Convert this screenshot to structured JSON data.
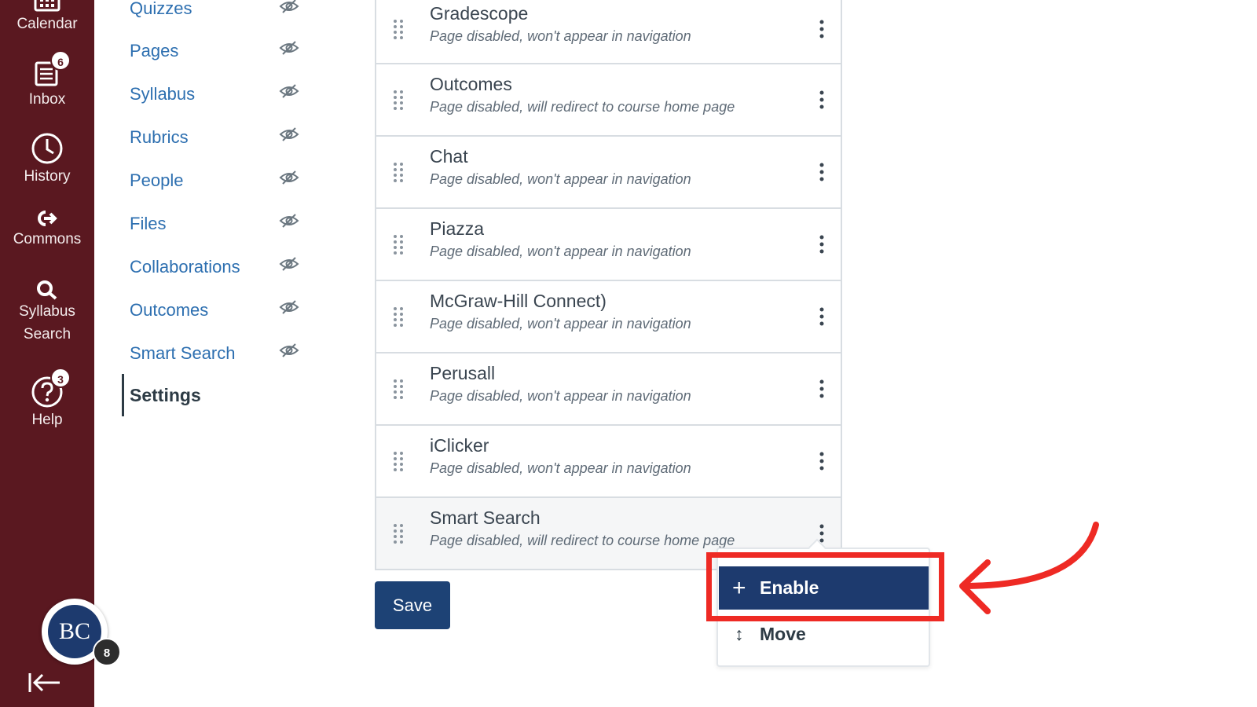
{
  "global_nav": {
    "calendar_label": "Calendar",
    "inbox_label": "Inbox",
    "inbox_badge": "6",
    "history_label": "History",
    "commons_label": "Commons",
    "syllabus_search_label_1": "Syllabus",
    "syllabus_search_label_2": "Search",
    "help_label": "Help",
    "help_badge": "3",
    "avatar_initials": "BC",
    "avatar_badge": "8"
  },
  "course_nav": {
    "items": [
      {
        "label": "Quizzes",
        "icon": "eye-slash-icon"
      },
      {
        "label": "Pages",
        "icon": "eye-slash-icon"
      },
      {
        "label": "Syllabus",
        "icon": "eye-slash-icon"
      },
      {
        "label": "Rubrics",
        "icon": "eye-slash-icon"
      },
      {
        "label": "People",
        "icon": "eye-slash-icon"
      },
      {
        "label": "Files",
        "icon": "eye-slash-icon"
      },
      {
        "label": "Collaborations",
        "icon": "eye-slash-icon"
      },
      {
        "label": "Outcomes",
        "icon": "eye-slash-icon"
      },
      {
        "label": "Smart Search",
        "icon": "eye-slash-icon"
      }
    ],
    "active_label": "Settings"
  },
  "disabled_items": [
    {
      "title": "Gradescope",
      "status": "Page disabled, won't appear in navigation"
    },
    {
      "title": "Outcomes",
      "status": "Page disabled, will redirect to course home page"
    },
    {
      "title": "Chat",
      "status": "Page disabled, won't appear in navigation"
    },
    {
      "title": "Piazza",
      "status": "Page disabled, won't appear in navigation"
    },
    {
      "title": "McGraw-Hill Connect)",
      "status": "Page disabled, won't appear in navigation"
    },
    {
      "title": "Perusall",
      "status": "Page disabled, won't appear in navigation"
    },
    {
      "title": "iClicker",
      "status": "Page disabled, won't appear in navigation"
    },
    {
      "title": "Smart Search",
      "status": "Page disabled, will redirect to course home page"
    }
  ],
  "save_label": "Save",
  "item_menu": {
    "enable_label": "Enable",
    "move_label": "Move"
  },
  "colors": {
    "global_nav_bg": "#5a1820",
    "link": "#2d6fb0",
    "primary_button": "#1d4275",
    "highlight": "#ee2a24"
  }
}
